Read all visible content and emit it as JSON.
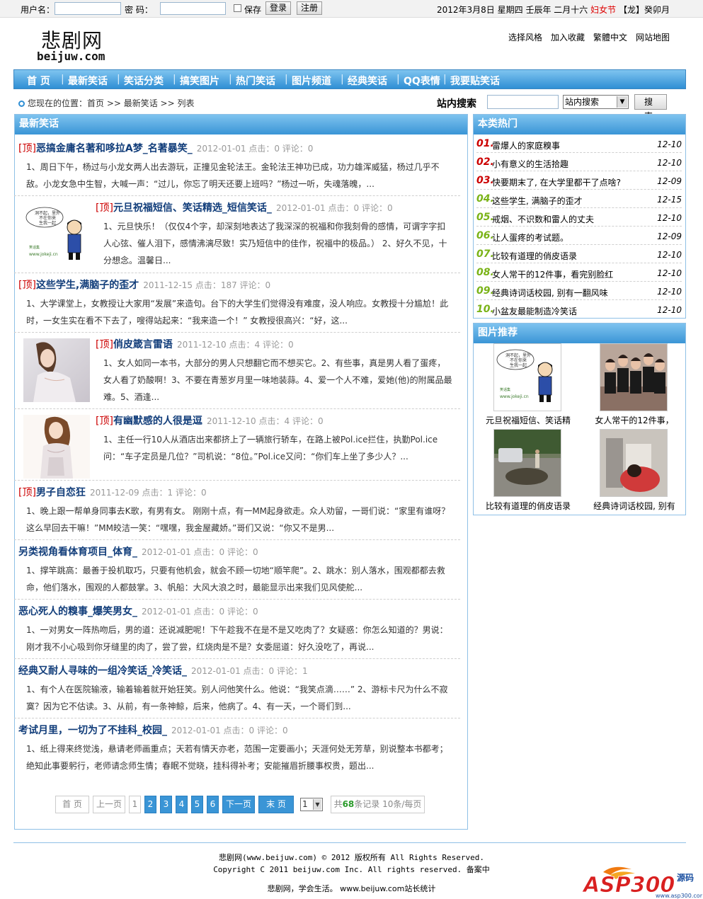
{
  "login": {
    "username_label": "用户名：",
    "password_label": "密  码：",
    "remember_label": "保存",
    "login_button": "登录",
    "register_button": "注册"
  },
  "date_bar": {
    "date": "2012年3月8日 星期四 壬辰年 二月十六",
    "holiday": "妇女节",
    "zodiac": "【龙】癸卯月"
  },
  "logo": {
    "cn": "悲剧网",
    "en": "beijuw.com"
  },
  "top_links": [
    "选择风格",
    "加入收藏",
    "繁體中文",
    "网站地图"
  ],
  "nav": [
    "首 页",
    "最新笑话",
    "笑话分类",
    "搞笑图片",
    "热门笑话",
    "图片频道",
    "经典笑话",
    "QQ表情",
    "我要贴笑话"
  ],
  "nav_separator": "|",
  "breadcrumb": "您现在的位置：首页 >> 最新笑话 >> 列表",
  "search": {
    "label": "站内搜索",
    "select_value": "站内搜索",
    "button": "搜 索"
  },
  "main_panel_title": "最新笑话",
  "articles": [
    {
      "tag": "[顶]",
      "title": "恶搞金庸名著和哆拉A梦_名著暴笑_",
      "meta": "2012-01-01 点击：0 评论：0",
      "desc": "1、周日下午，杨过与小龙女两人出去游玩，正撞见金轮法王。金轮法王神功已成，功力雄浑威猛，杨过几乎不敌。小龙女急中生智，大喊一声：“过儿，你忘了明天还要上班吗？”杨过一听，失魂落魄，...",
      "thumb": ""
    },
    {
      "tag": "[顶]",
      "title": "元旦祝福短信、笑话精选_短信笑话_",
      "meta": "2012-01-01 点击：0 评论：0",
      "desc": "1、元旦快乐！（仅仅4个字，却深刻地表达了我深深的祝福和你我刻骨的感情，可谓字字扣人心弦、催人泪下，感情沸漓尽致！实乃短信中的佳作，祝福中的极品。） 2、好久不见，十分想念。温馨日...",
      "thumb": "cartoon"
    },
    {
      "tag": "[顶]",
      "title": "这些学生,满脑子的歪才",
      "meta": "2011-12-15 点击：187 评论：0",
      "desc": "1、大学课堂上，女教授让大家用“发展”来造句。台下的大学生们觉得没有难度，没人响应。女教授十分尴尬！此时，一女生实在看不下去了，嗖得站起来：“我来造一个！” 女教授很高兴：“好，这...",
      "thumb": ""
    },
    {
      "tag": "[顶]",
      "title": "俏皮箴言雷语",
      "meta": "2011-12-10 点击：4 评论：0",
      "desc": "1、女人如同一本书，大部分的男人只想翻它而不想买它。2、有些事，真是男人看了蛋疼，女人看了奶酸啊！3、不要在青葱岁月里一味地装蒜。4、爱一个人不难，爱她(他)的附属品最难。5、酒逢...",
      "thumb": "photo1"
    },
    {
      "tag": "[顶]",
      "title": "有幽默感的人很是逗",
      "meta": "2011-12-10 点击：4 评论：0",
      "desc": "1、主任一行10人从酒店出来都挤上了一辆旅行轿车，在路上被Pol.ice拦住，执勤Pol.ice问：“车子定员是几位？”司机说：“8位。”Pol.ice又问：“你们车上坐了多少人？...",
      "thumb": "photo2"
    },
    {
      "tag": "[顶]",
      "title": "男子自恋狂",
      "meta": "2011-12-09 点击：1 评论：0",
      "desc": "1、晚上跟一帮单身同事去K歌，有男有女。 刚刚十点，有一MM起身欲走。众人劝留，一哥们说：“家里有谁呀？这么早回去干嘛！”MM皎洁一笑：“嘿嘿，我金屋藏娇。”哥们又说：“你又不是男...",
      "thumb": ""
    },
    {
      "tag": "",
      "title": "另类视角看体育项目_体育_",
      "meta": "2012-01-01 点击：0 评论：0",
      "desc": "1、撑竿跳高：最善于投机取巧，只要有他机会，就会不顾一切地“顺竿爬”。2、跳水：别人落水，围观都都去救命，他们落水，围观的人都鼓掌。3、帆船：大风大浪之时，最能显示出来我们见风使舵...",
      "thumb": ""
    },
    {
      "tag": "",
      "title": "恶心死人的糗事_爆笑男女_",
      "meta": "2012-01-01 点击：0 评论：0",
      "desc": "1、一对男女一阵热吻后，男的道：还说减肥呢！下午趁我不在是不是又吃肉了？女疑惑：你怎么知道的？男说：刚才我不小心吸到你牙缝里的肉了，尝了尝，红烧肉是不是？女委屈道：好久没吃了，再说...",
      "thumb": ""
    },
    {
      "tag": "",
      "title": "经典又耐人寻味的一组冷笑话_冷笑话_",
      "meta": "2012-01-01 点击：0 评论：1",
      "desc": "1、有个人在医院输液，输着输着就开始狂笑。别人问他笑什么。他说：“我笑点滴……” 2、游标卡尺为什么不寂寞？因为它不估读。3、从前，有一条神鲸，后来，他病了。4、有一天，一个哥们到...",
      "thumb": ""
    },
    {
      "tag": "",
      "title": "考试月里，一切为了不挂科_校园_",
      "meta": "2012-01-01 点击：0 评论：0",
      "desc": "1、纸上得来终觉浅，悬请老师画重点；天若有情天亦老，范围一定要画小；天涯何处无芳草，别说整本书都考；绝知此事要躬行，老师请念师生情；春眠不觉晓，挂科得补考；安能摧眉折腰事权贵，题出...",
      "thumb": ""
    }
  ],
  "pager": {
    "first": "首 页",
    "prev": "上一页",
    "pages": [
      "1",
      "2",
      "3",
      "4",
      "5",
      "6"
    ],
    "current": "1",
    "next": "下一页",
    "last": "末 页",
    "select_value": "1",
    "info_prefix": "共",
    "total": "68",
    "info_suffix": "条记录 10条/每页"
  },
  "hot_panel_title": "本类热门",
  "hot_list": [
    {
      "num": "01.",
      "title": "雷爆人的家庭糗事",
      "date": "12-10",
      "color": "#cc0000"
    },
    {
      "num": "02.",
      "title": "小有意义的生活拾趣",
      "date": "12-10",
      "color": "#cc0000"
    },
    {
      "num": "03.",
      "title": "快要期末了, 在大学里都干了点啥?",
      "date": "12-09",
      "color": "#cc0000"
    },
    {
      "num": "04.",
      "title": "这些学生, 满脑子的歪才",
      "date": "12-15",
      "color": "#7ab317"
    },
    {
      "num": "05.",
      "title": "戒烟、不识数和雷人的丈夫",
      "date": "12-10",
      "color": "#7ab317"
    },
    {
      "num": "06.",
      "title": "让人蛋疼的考试题。",
      "date": "12-09",
      "color": "#7ab317"
    },
    {
      "num": "07.",
      "title": "比较有道理的俏皮语录",
      "date": "12-10",
      "color": "#7ab317"
    },
    {
      "num": "08.",
      "title": "女人常干的12件事，看完别脸红",
      "date": "12-10",
      "color": "#7ab317"
    },
    {
      "num": "09.",
      "title": "经典诗词话校园, 别有一翻风味",
      "date": "12-10",
      "color": "#7ab317"
    },
    {
      "num": "10.",
      "title": "小盆友最能制造冷笑话",
      "date": "12-10",
      "color": "#7ab317"
    }
  ],
  "pic_panel_title": "图片推荐",
  "pic_list": [
    {
      "title": "元旦祝福短信、笑话精",
      "kind": "cartoon"
    },
    {
      "title": "女人常干的12件事，",
      "kind": "group"
    },
    {
      "title": "比较有道理的俏皮语录",
      "kind": "street"
    },
    {
      "title": "经典诗词话校园, 别有",
      "kind": "sleep"
    }
  ],
  "cartoon_text": "洞不起，里外\n不在你来\n生我一起",
  "cartoon_site": "www.jokeji.cn",
  "footer": {
    "line1": "悲剧网(www.beijuw.com) © 2012 版权所有 All Rights Reserved.",
    "line2": "Copyright C 2011 beijuw.com Inc. All rights reserved. 备案中",
    "line3": "悲剧网，学会生活。 www.beijuw.com站长统计"
  },
  "watermark": {
    "text": "ASP300",
    "sub": "源码",
    "url": "www.asp300.com"
  },
  "colors": {
    "nav_blue": "#2f8fd4",
    "title_blue": "#113d7a",
    "tag_red": "#cc0000",
    "hot_red": "#cc0000",
    "hot_green": "#7ab317",
    "pager_blue": "#3a95d6"
  }
}
